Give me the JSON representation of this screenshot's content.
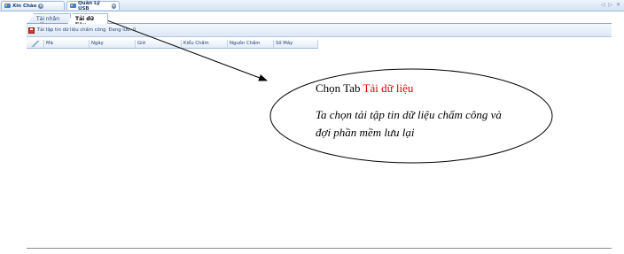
{
  "doc_tabs": [
    {
      "label": "Xin Chào"
    },
    {
      "label": "Quản Lý USB"
    }
  ],
  "nav_arrows": "◁ ▷ ✕",
  "inner_tabs": [
    {
      "label": "Tải nhân viên"
    },
    {
      "label": "Tải dữ liệu"
    }
  ],
  "toolbar": {
    "load_label": "Tải tập tin dữ liệu chấm công",
    "status_text": "Đang lưu: 0"
  },
  "grid": {
    "columns": [
      "Mã",
      "Ngày",
      "Giờ",
      "Kiểu Chấm",
      "Nguồn Chấm",
      "Số Máy"
    ]
  },
  "callout": {
    "title_prefix": "Chọn Tab",
    "title_highlight": "Tải dữ liệu",
    "body": "Ta chọn tải tập tin dữ liệu chấm công và đợi phần mềm lưu lại",
    "highlight_color": "#e00000"
  }
}
